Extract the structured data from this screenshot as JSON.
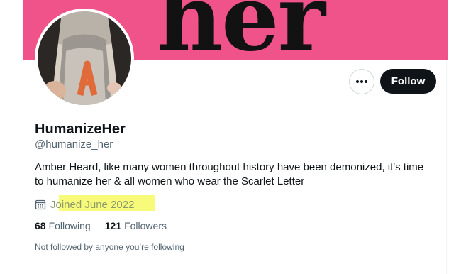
{
  "banner": {
    "art_text": "her",
    "color": "#f0528a"
  },
  "actions": {
    "more_icon": "more-horizontal-icon",
    "follow_label": "Follow"
  },
  "profile": {
    "name": "HumanizeHer",
    "handle": "@humanize_her",
    "bio": "Amber Heard, like many women throughout history have been demonized, it's time to humanize her & all women who wear the Scarlet Letter",
    "joined_icon": "calendar-icon",
    "joined": "Joined June 2022",
    "joined_highlight_color": "#f8fa7a"
  },
  "stats": {
    "following_count": "68",
    "following_label": "Following",
    "followers_count": "121",
    "followers_label": "Followers"
  },
  "note": "Not followed by anyone you’re following"
}
